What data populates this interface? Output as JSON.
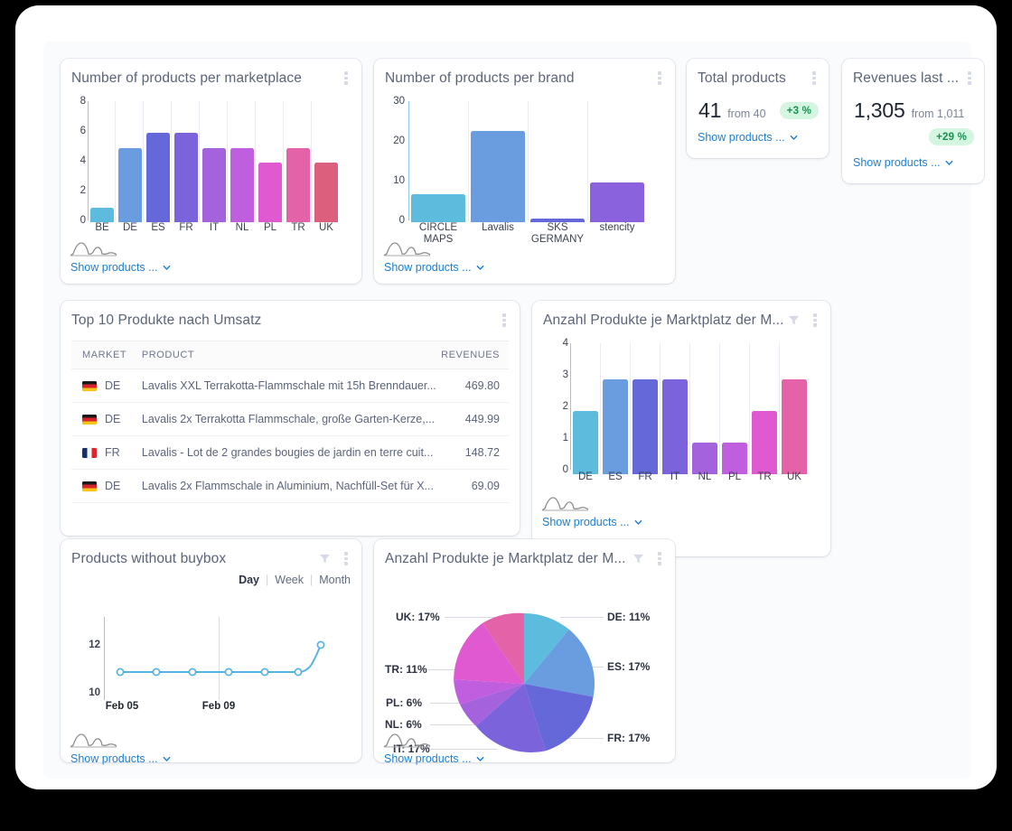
{
  "common": {
    "show_products_label": "Show products ...",
    "kebab_icon": "kebab-menu-icon",
    "filter_icon": "funnel-filter-icon",
    "distribution_icon": "distribution-curve-icon",
    "chevron_icon": "chevron-down-icon",
    "link_color": "#1b7fd4"
  },
  "cards": {
    "products_per_marketplace": {
      "title": "Number of products per marketplace"
    },
    "products_per_brand": {
      "title": "Number of products per brand"
    },
    "total_products": {
      "title": "Total products",
      "value": "41",
      "from": "from 40",
      "badge": "+3 %",
      "badge_color": "#1a8f52"
    },
    "revenues_last": {
      "title": "Revenues last ...",
      "value": "1,305",
      "from": "from 1,011",
      "badge": "+29 %",
      "badge_color": "#1a8f52"
    },
    "top10": {
      "title": "Top 10 Produkte nach Umsatz",
      "columns": [
        "MARKET",
        "PRODUCT",
        "REVENUES"
      ],
      "rows": [
        {
          "flag": "de",
          "market": "DE",
          "product": "Lavalis XXL Terrakotta-Flammschale mit 15h Brenndauer...",
          "revenue": "469.80"
        },
        {
          "flag": "de",
          "market": "DE",
          "product": "Lavalis 2x Terrakotta Flammschale, große Garten-Kerze,...",
          "revenue": "449.99"
        },
        {
          "flag": "fr",
          "market": "FR",
          "product": "Lavalis - Lot de 2 grandes bougies de jardin en terre cuit...",
          "revenue": "148.72"
        },
        {
          "flag": "de",
          "market": "DE",
          "product": "Lavalis 2x Flammschale in Aluminium, Nachfüll-Set für X...",
          "revenue": "69.09"
        }
      ]
    },
    "products_per_marketplace_month": {
      "title": "Anzahl Produkte je Marktplatz der M..."
    },
    "products_without_buybox": {
      "title": "Products without buybox",
      "granularity": {
        "options": [
          "Day",
          "Week",
          "Month"
        ],
        "selected": "Day"
      }
    },
    "products_per_marketplace_pie": {
      "title": "Anzahl Produkte je Marktplatz der M..."
    }
  },
  "chart_data": [
    {
      "id": "products-per-marketplace",
      "type": "bar",
      "title": "Number of products per marketplace",
      "categories": [
        "BE",
        "DE",
        "ES",
        "FR",
        "IT",
        "NL",
        "PL",
        "TR",
        "UK"
      ],
      "values": [
        1,
        5,
        6,
        6,
        5,
        5,
        4,
        5,
        4
      ],
      "colors": [
        "#5dbcdd",
        "#6a9ce0",
        "#6568d8",
        "#7a63db",
        "#a濃",
        "#c濃",
        "#e濃",
        "#e濃",
        "#d濃"
      ],
      "bar_colors": [
        "#5dbcdd",
        "#6a9ce0",
        "#6568d8",
        "#7a63db",
        "#a462dd",
        "#c05ee0",
        "#e059d0",
        "#e462a8",
        "#dd5f7e"
      ],
      "xlabel": "",
      "ylabel": "",
      "ylim": [
        0,
        8
      ],
      "yticks": [
        0,
        2,
        4,
        6,
        8
      ],
      "grid": true
    },
    {
      "id": "products-per-brand",
      "type": "bar",
      "title": "Number of products per brand",
      "categories": [
        "CIRCLE MAPS",
        "Lavalis",
        "SKS GERMANY",
        "stencity"
      ],
      "values": [
        7,
        23,
        1,
        10
      ],
      "bar_colors": [
        "#5dbcdd",
        "#6a9ce0",
        "#6568d8",
        "#8a62dd"
      ],
      "xlabel": "",
      "ylabel": "",
      "ylim": [
        0,
        30
      ],
      "yticks": [
        0,
        10,
        20,
        30
      ],
      "grid": true
    },
    {
      "id": "products-per-marketplace-month",
      "type": "bar",
      "title": "Anzahl Produkte je Marktplatz der M...",
      "categories": [
        "DE",
        "ES",
        "FR",
        "IT",
        "NL",
        "PL",
        "TR",
        "UK"
      ],
      "values": [
        2,
        3,
        3,
        3,
        1,
        1,
        2,
        3
      ],
      "bar_colors": [
        "#5dbcdd",
        "#6a9ce0",
        "#6568d8",
        "#7a63db",
        "#a462dd",
        "#c05ee0",
        "#e059d0",
        "#e462a8"
      ],
      "xlabel": "",
      "ylabel": "",
      "ylim": [
        0,
        4
      ],
      "yticks": [
        0,
        1,
        2,
        3,
        4
      ],
      "grid": true
    },
    {
      "id": "products-without-buybox",
      "type": "line",
      "title": "Products without buybox",
      "x": [
        "Feb 05",
        "",
        "",
        "",
        "",
        "Feb 09",
        ""
      ],
      "xtick_labels": [
        "Feb 05",
        "Feb 09"
      ],
      "values": [
        11,
        11,
        11,
        11,
        11,
        11,
        12
      ],
      "line_color": "#56b4e0",
      "ylim": [
        10,
        12
      ],
      "yticks": [
        10,
        12
      ],
      "grid": false
    },
    {
      "id": "products-per-marketplace-pie",
      "type": "pie",
      "title": "Anzahl Produkte je Marktplatz der M...",
      "labels": [
        "DE",
        "ES",
        "FR",
        "IT",
        "NL",
        "PL",
        "TR",
        "UK"
      ],
      "values": [
        11,
        17,
        17,
        17,
        6,
        6,
        11,
        17
      ],
      "display_labels": [
        "DE: 11%",
        "ES: 17%",
        "FR: 17%",
        "IT: 17%",
        "NL: 6%",
        "PL: 6%",
        "TR: 11%",
        "UK: 17%"
      ],
      "slice_colors": [
        "#5dbcdd",
        "#6a9ce0",
        "#6568d8",
        "#7a63db",
        "#a462dd",
        "#c05ee0",
        "#e059d0",
        "#e462a8"
      ],
      "legend": "outer-labels"
    }
  ]
}
